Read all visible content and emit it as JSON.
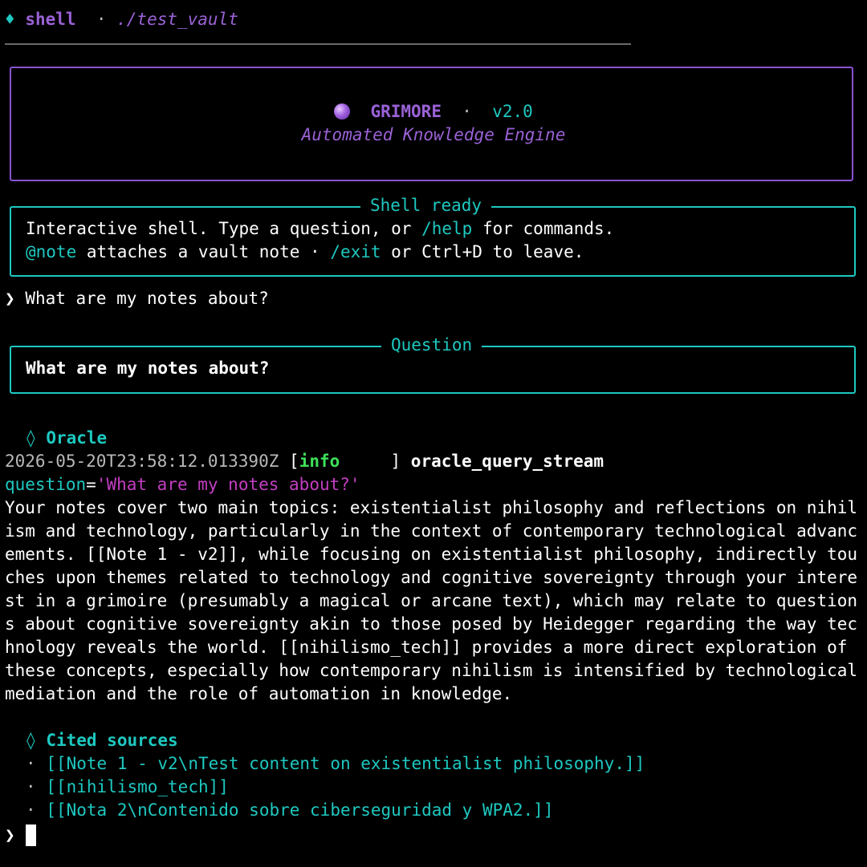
{
  "header": {
    "icon": "diamond-icon",
    "icon_glyph": "♦",
    "title": "shell",
    "separator": "·",
    "path": "./test_vault"
  },
  "banner": {
    "icon": "crystal-ball-icon",
    "name": "GRIMORE",
    "separator": "·",
    "version": "v2.0",
    "subtitle": "Automated Knowledge Engine"
  },
  "ready_panel": {
    "title": "Shell ready",
    "line1_pre": "Interactive shell. Type a question, or ",
    "line1_cmd": "/help",
    "line1_post": " for commands.",
    "line2_cmd1": "@note",
    "line2_mid": " attaches a vault note · ",
    "line2_cmd2": "/exit",
    "line2_post": " or Ctrl+D to leave."
  },
  "prompt": {
    "symbol": "❯",
    "input": "What are my notes about?"
  },
  "question_panel": {
    "title": "Question",
    "text": "What are my notes about?"
  },
  "oracle": {
    "icon_glyph": "◊",
    "heading": "Oracle",
    "log_timestamp": "2026-05-20T23:58:12.013390Z",
    "log_bracket_open": "[",
    "log_level": "info     ",
    "log_bracket_close": "]",
    "log_event": "oracle_query_stream",
    "kv_key": "question",
    "kv_eq": "=",
    "kv_value": "'What are my notes about?'",
    "answer": "Your notes cover two main topics: existentialist philosophy and reflections on nihilism and technology, particularly in the context of contemporary technological advancements. [[Note 1 - v2]], while focusing on existentialist philosophy, indirectly touches upon themes related to technology and cognitive sovereignty through your interest in a grimoire (presumably a magical or arcane text), which may relate to questions about cognitive sovereignty akin to those posed by Heidegger regarding the way technology reveals the world. [[nihilismo_tech]] provides a more direct exploration of these concepts, especially how contemporary nihilism is intensified by technological mediation and the role of automation in knowledge."
  },
  "cited": {
    "icon_glyph": "◊",
    "heading": "Cited sources",
    "bullet": "·",
    "sources": [
      "[[Note 1 - v2\\nTest content on existentialist philosophy.]]",
      "[[nihilismo_tech]]",
      "[[Nota 2\\nContenido sobre ciberseguridad y WPA2.]]"
    ]
  },
  "final_prompt": {
    "symbol": "❯"
  },
  "colors": {
    "teal": "#1ec8c0",
    "purple": "#9a62d6",
    "magenta": "#c23ec2",
    "green": "#3ee05a",
    "background": "#000000"
  }
}
